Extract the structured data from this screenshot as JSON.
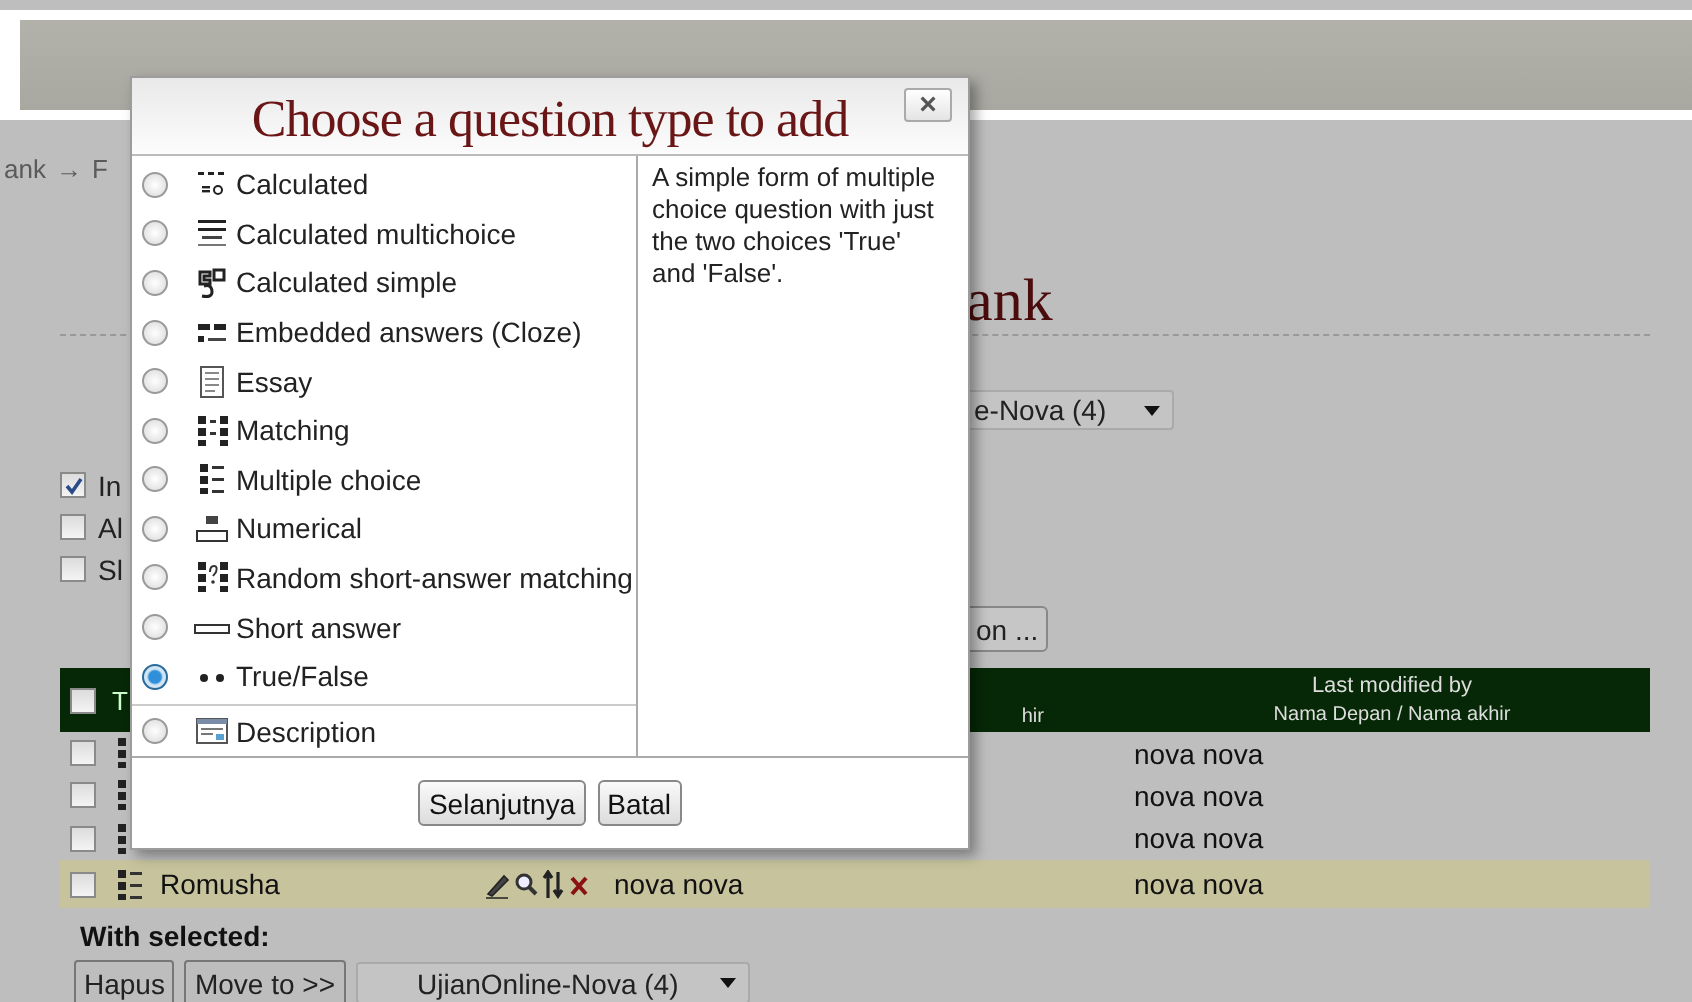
{
  "breadcrumb": [
    "ank",
    "→",
    "F"
  ],
  "heading": "ank",
  "category_select": {
    "value": "e-Nova (4)"
  },
  "options": [
    {
      "label": "In",
      "checked": true
    },
    {
      "label": "Al",
      "checked": false
    },
    {
      "label": "Sl",
      "checked": false
    }
  ],
  "create_button": "on ...",
  "table": {
    "header": {
      "checked": false,
      "type": "T",
      "created_by": "hir",
      "last_modified": "Last modified by",
      "last_modified_sub": "Nama Depan / Nama akhir"
    },
    "rows": [
      {
        "checked": false,
        "highlighted": false,
        "last_modified": "nova nova"
      },
      {
        "checked": false,
        "highlighted": false,
        "last_modified": "nova nova"
      },
      {
        "checked": false,
        "highlighted": false,
        "last_modified": "nova nova"
      },
      {
        "checked": false,
        "highlighted": true,
        "name": "Romusha",
        "created_by": "nova nova",
        "last_modified": "nova nova"
      }
    ]
  },
  "with_selected": {
    "label": "With selected:",
    "buttons": [
      "Hapus",
      "Move to >>"
    ],
    "select": "UjianOnline-Nova (4)"
  },
  "dialog": {
    "title": "Choose a question type to add",
    "close": "×",
    "question_types": [
      {
        "label": "Calculated",
        "selected": false
      },
      {
        "label": "Calculated multichoice",
        "selected": false
      },
      {
        "label": "Calculated simple",
        "selected": false
      },
      {
        "label": "Embedded answers (Cloze)",
        "selected": false
      },
      {
        "label": "Essay",
        "selected": false
      },
      {
        "label": "Matching",
        "selected": false
      },
      {
        "label": "Multiple choice",
        "selected": false
      },
      {
        "label": "Numerical",
        "selected": false
      },
      {
        "label": "Random short-answer matching",
        "selected": false
      },
      {
        "label": "Short answer",
        "selected": false
      },
      {
        "label": "True/False",
        "selected": true
      }
    ],
    "other_types": [
      {
        "label": "Description",
        "selected": false
      }
    ],
    "description": "A simple form of multiple choice question with just the two choices 'True' and 'False'.",
    "buttons": [
      "Selanjutnya",
      "Batal"
    ]
  }
}
